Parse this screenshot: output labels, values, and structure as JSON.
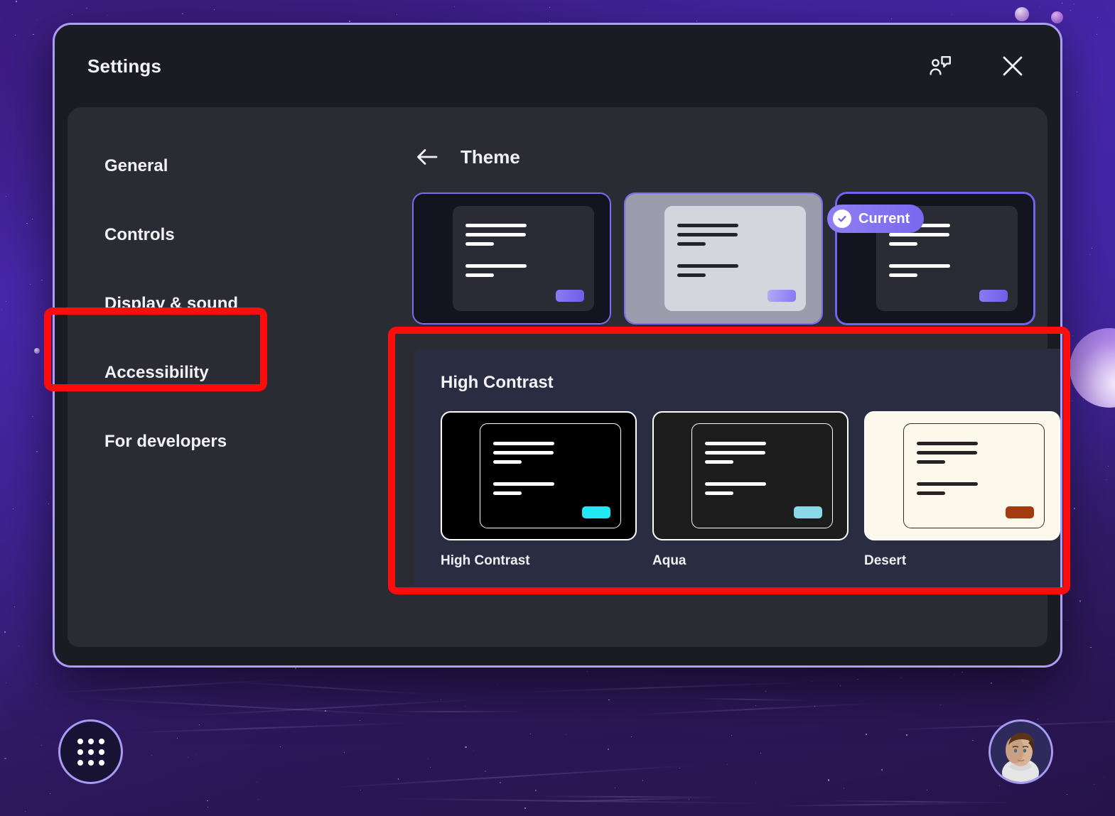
{
  "window": {
    "title": "Settings",
    "feedback_icon": "person-speech-bubble-icon",
    "close_icon": "close-icon"
  },
  "sidebar": {
    "items": [
      {
        "label": "General",
        "name": "general"
      },
      {
        "label": "Controls",
        "name": "controls"
      },
      {
        "label": "Display & sound",
        "name": "display-and-sound"
      },
      {
        "label": "Accessibility",
        "name": "accessibility"
      },
      {
        "label": "For developers",
        "name": "for-developers"
      }
    ]
  },
  "content": {
    "back_icon": "back-arrow-icon",
    "title": "Theme",
    "themes": [
      {
        "name": "dark-theme",
        "selected": false
      },
      {
        "name": "light-theme",
        "selected": false
      },
      {
        "name": "current-theme",
        "selected": true,
        "badge_label": "Current",
        "badge_icon": "check-circle-icon"
      }
    ],
    "high_contrast": {
      "heading": "High Contrast",
      "options": [
        {
          "label": "High Contrast",
          "accent": "#22e7f5",
          "surface": "#000000"
        },
        {
          "label": "Aqua",
          "accent": "#8ad9e8",
          "surface": "#1d1d1d"
        },
        {
          "label": "Desert",
          "accent": "#a43a10",
          "surface": "#fdf8ec"
        }
      ]
    }
  },
  "taskbar": {
    "launcher_icon": "app-grid-icon",
    "avatar_icon": "user-avatar"
  },
  "annotations": {
    "color": "#fb0d0d",
    "targets": [
      "accessibility-nav-item",
      "high-contrast-section"
    ]
  }
}
